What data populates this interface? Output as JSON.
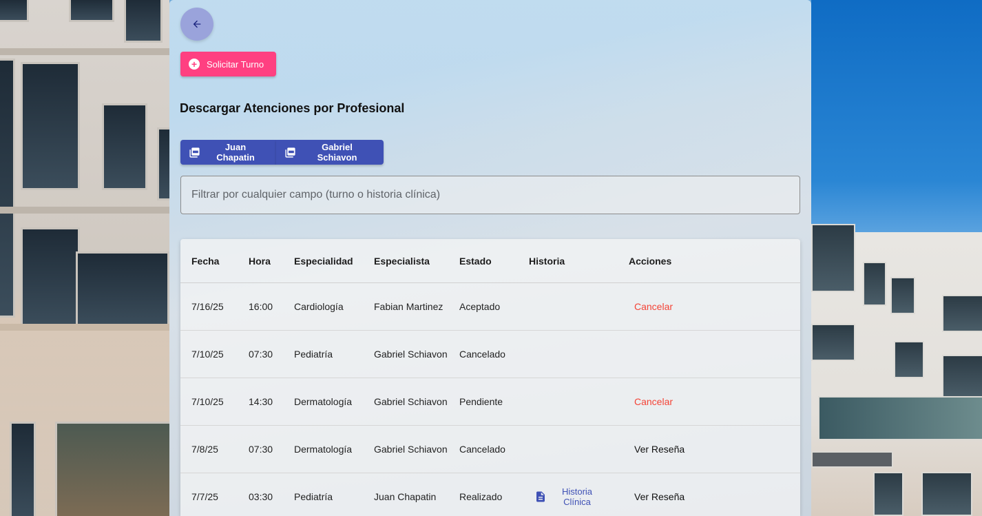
{
  "colors": {
    "accent": "#ff4081",
    "primary": "#3f51b5",
    "back_button": "#9aa3db",
    "cancel": "#f44336"
  },
  "header": {
    "back_icon": "arrow-back-icon",
    "solicitar_label": "Solicitar Turno",
    "solicitar_icon": "add-circle-icon"
  },
  "downloads": {
    "title": "Descargar Atenciones por Profesional",
    "icon": "pdf-icon",
    "buttons": [
      {
        "label": "Juan Chapatin"
      },
      {
        "label": "Gabriel Schiavon"
      }
    ]
  },
  "filter": {
    "placeholder": "Filtrar por cualquier campo (turno o historia clínica)",
    "value": ""
  },
  "table": {
    "headers": {
      "fecha": "Fecha",
      "hora": "Hora",
      "especialidad": "Especialidad",
      "especialista": "Especialista",
      "estado": "Estado",
      "historia": "Historia",
      "acciones": "Acciones"
    },
    "rows": [
      {
        "fecha": "7/16/25",
        "hora": "16:00",
        "especialidad": "Cardiología",
        "especialista": "Fabian Martinez",
        "estado": "Aceptado",
        "historia": "",
        "accion": "Cancelar"
      },
      {
        "fecha": "7/10/25",
        "hora": "07:30",
        "especialidad": "Pediatría",
        "especialista": "Gabriel Schiavon",
        "estado": "Cancelado",
        "historia": "",
        "accion": ""
      },
      {
        "fecha": "7/10/25",
        "hora": "14:30",
        "especialidad": "Dermatología",
        "especialista": "Gabriel Schiavon",
        "estado": "Pendiente",
        "historia": "",
        "accion": "Cancelar"
      },
      {
        "fecha": "7/8/25",
        "hora": "07:30",
        "especialidad": "Dermatología",
        "especialista": "Gabriel Schiavon",
        "estado": "Cancelado",
        "historia": "",
        "accion": "Ver Reseña"
      },
      {
        "fecha": "7/7/25",
        "hora": "03:30",
        "especialidad": "Pediatría",
        "especialista": "Juan Chapatin",
        "estado": "Realizado",
        "historia": "Historia Clínica",
        "historia_icon": "document-icon",
        "accion": "Ver Reseña"
      }
    ]
  }
}
